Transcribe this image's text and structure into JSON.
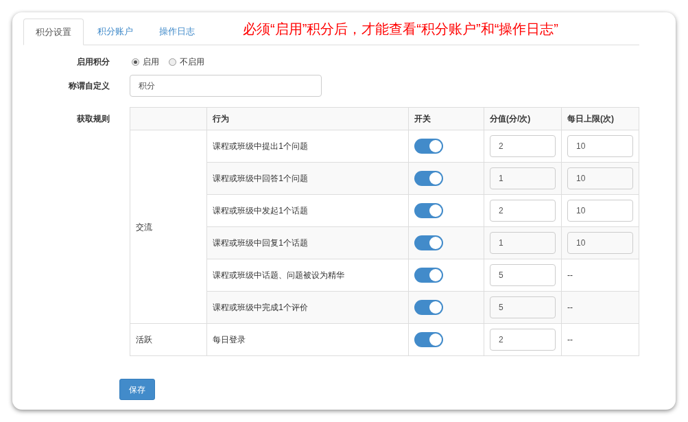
{
  "tabs": [
    {
      "label": "积分设置",
      "selected": true
    },
    {
      "label": "积分账户",
      "selected": false
    },
    {
      "label": "操作日志",
      "selected": false
    }
  ],
  "notice": "必须“启用”积分后，才能查看“积分账户”和“操作日志”",
  "enable": {
    "label": "启用积分",
    "options": [
      {
        "label": "启用",
        "selected": true
      },
      {
        "label": "不启用",
        "selected": false
      }
    ]
  },
  "title_field": {
    "label": "称谓自定义",
    "value": "积分"
  },
  "rules": {
    "label": "获取规则",
    "columns": [
      "行为",
      "开关",
      "分值(分/次)",
      "每日上限(次)"
    ],
    "groups": [
      {
        "name": "交流",
        "rows": [
          {
            "action": "课程或班级中提出1个问题",
            "on": true,
            "score": "2",
            "limit": {
              "kind": "input",
              "value": "10"
            }
          },
          {
            "action": "课程或班级中回答1个问题",
            "on": true,
            "score": "1",
            "limit": {
              "kind": "input",
              "value": "10"
            }
          },
          {
            "action": "课程或班级中发起1个话题",
            "on": true,
            "score": "2",
            "limit": {
              "kind": "input",
              "value": "10"
            }
          },
          {
            "action": "课程或班级中回复1个话题",
            "on": true,
            "score": "1",
            "limit": {
              "kind": "input",
              "value": "10"
            }
          },
          {
            "action": "课程或班级中话题、问题被设为精华",
            "on": true,
            "score": "5",
            "limit": {
              "kind": "text",
              "value": "--"
            }
          },
          {
            "action": "课程或班级中完成1个评价",
            "on": true,
            "score": "5",
            "limit": {
              "kind": "text",
              "value": "--"
            }
          }
        ]
      },
      {
        "name": "活跃",
        "rows": [
          {
            "action": "每日登录",
            "on": true,
            "score": "2",
            "limit": {
              "kind": "text",
              "value": "--"
            }
          }
        ]
      }
    ]
  },
  "save_button": "保存"
}
